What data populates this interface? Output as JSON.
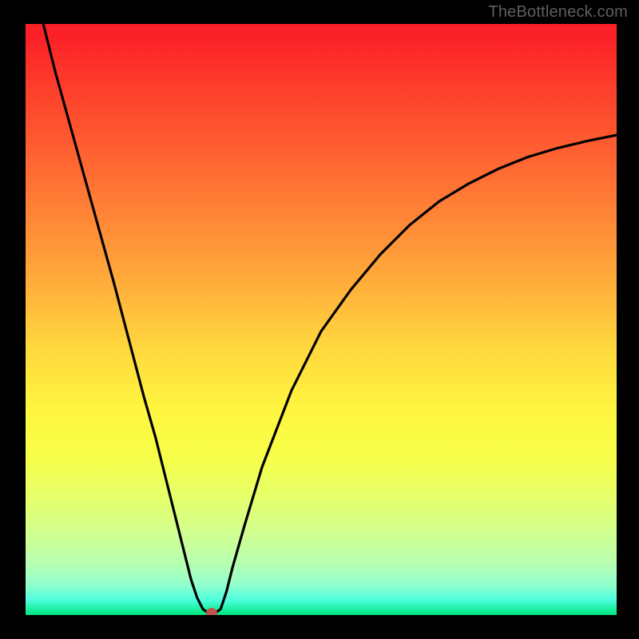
{
  "watermark": "TheBottleneck.com",
  "chart_data": {
    "type": "line",
    "title": "",
    "xlabel": "",
    "ylabel": "",
    "xlim": [
      0,
      100
    ],
    "ylim": [
      0,
      100
    ],
    "grid": false,
    "legend": false,
    "series": [
      {
        "name": "curve",
        "x": [
          3,
          5,
          10,
          15,
          20,
          22,
          25,
          27,
          28,
          29,
          30,
          31,
          32,
          33,
          34,
          35,
          37,
          40,
          45,
          50,
          55,
          60,
          65,
          70,
          75,
          80,
          85,
          90,
          95,
          100
        ],
        "y": [
          100,
          92,
          74,
          56,
          37,
          30,
          18,
          10,
          6,
          3,
          1,
          0.3,
          0.3,
          1,
          4,
          8,
          15,
          25,
          38,
          48,
          55,
          61,
          66,
          70,
          73,
          75.5,
          77.5,
          79,
          80.2,
          81.2
        ]
      }
    ],
    "marker": {
      "x": 31.5,
      "y": 0.3
    },
    "colors": {
      "curve": "#000000",
      "marker": "#c1554d",
      "background_top": "#fb2028",
      "background_bottom": "#00e47a"
    }
  }
}
